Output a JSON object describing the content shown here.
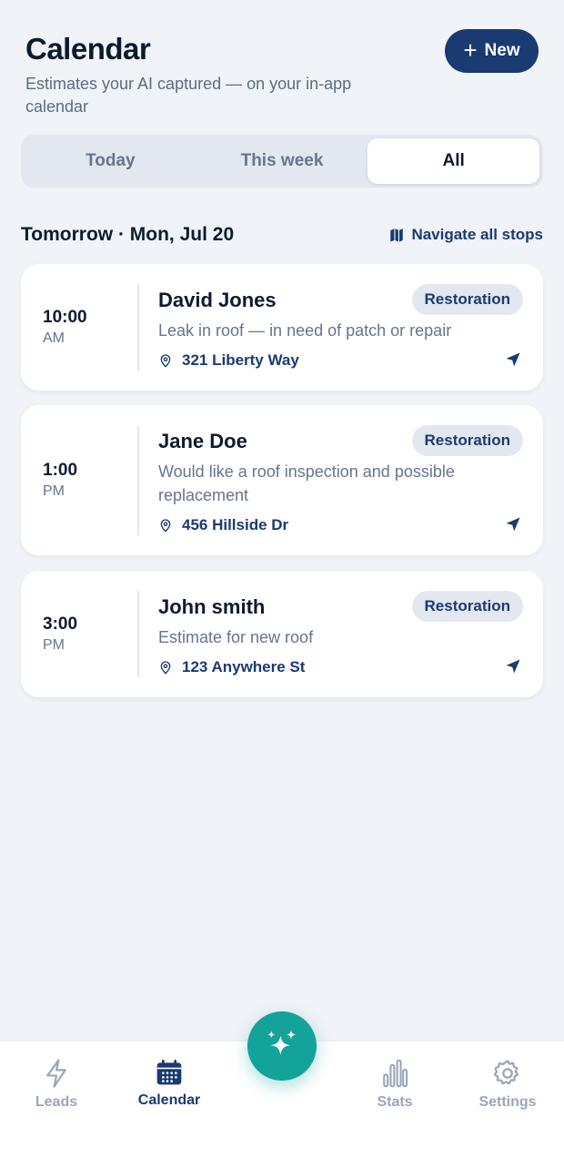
{
  "header": {
    "title": "Calendar",
    "subtitle": "Estimates your AI captured — on your in-app calendar",
    "new_label": "New"
  },
  "filters": {
    "tabs": [
      {
        "label": "Today",
        "active": false
      },
      {
        "label": "This week",
        "active": false
      },
      {
        "label": "All",
        "active": true
      }
    ]
  },
  "section": {
    "title": "Tomorrow · Mon, Jul 20",
    "navigate_label": "Navigate all stops"
  },
  "appointments": [
    {
      "time": "10:00",
      "ampm": "AM",
      "name": "David Jones",
      "tag": "Restoration",
      "description": "Leak in roof — in need of patch or repair",
      "address": "321 Liberty Way"
    },
    {
      "time": "1:00",
      "ampm": "PM",
      "name": "Jane Doe",
      "tag": "Restoration",
      "description": "Would like a roof inspection and possible replacement",
      "address": "456 Hillside Dr"
    },
    {
      "time": "3:00",
      "ampm": "PM",
      "name": "John smith",
      "tag": "Restoration",
      "description": "Estimate for new roof",
      "address": "123 Anywhere St"
    }
  ],
  "tabbar": {
    "items": [
      {
        "label": "Leads",
        "icon": "bolt-icon",
        "active": false
      },
      {
        "label": "Calendar",
        "icon": "calendar-icon",
        "active": true
      },
      {
        "label": "Stats",
        "icon": "bar-chart-icon",
        "active": false
      },
      {
        "label": "Settings",
        "icon": "gear-icon",
        "active": false
      }
    ]
  },
  "colors": {
    "background": "#f0f3f8",
    "primary": "#1a3a72",
    "accent": "#14a39a",
    "muted": "#66758c"
  }
}
